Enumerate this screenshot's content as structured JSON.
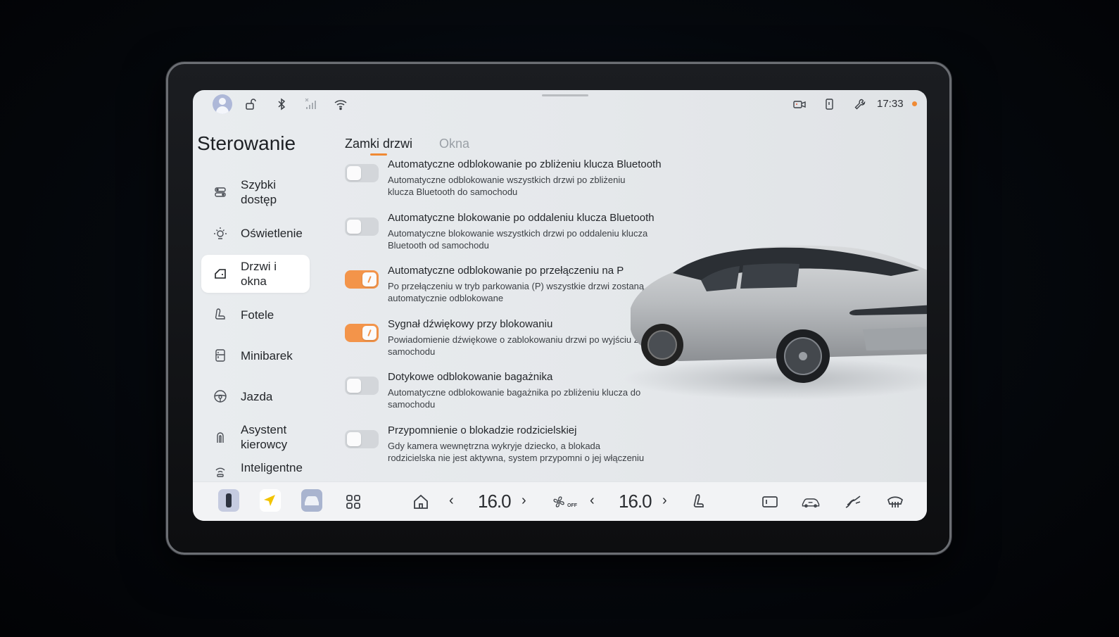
{
  "status_bar": {
    "time": "17:33",
    "icons": [
      "avatar",
      "unlock-icon",
      "bluetooth-icon",
      "no-signal-icon",
      "wifi-icon",
      "camera-icon",
      "phone-key-icon",
      "wrench-icon"
    ],
    "accent_color": "#f08a34"
  },
  "sidebar": {
    "title": "Sterowanie",
    "items": [
      {
        "label": "Szybki dostęp",
        "icon": "quick-access-icon",
        "active": false
      },
      {
        "label": "Oświetlenie",
        "icon": "light-icon",
        "active": false
      },
      {
        "label": "Drzwi i okna",
        "icon": "door-icon",
        "active": true
      },
      {
        "label": "Fotele",
        "icon": "seat-icon",
        "active": false
      },
      {
        "label": "Minibarek",
        "icon": "fridge-icon",
        "active": false
      },
      {
        "label": "Jazda",
        "icon": "steering-wheel-icon",
        "active": false
      },
      {
        "label": "Asystent kierowcy",
        "icon": "assistant-icon",
        "active": false
      },
      {
        "label": "Inteligentne",
        "icon": "smart-icon",
        "active": false
      }
    ]
  },
  "tabs": [
    {
      "label": "Zamki drzwi",
      "active": true
    },
    {
      "label": "Okna",
      "active": false
    }
  ],
  "settings": [
    {
      "title": "Automatyczne odblokowanie po zbliżeniu klucza Bluetooth",
      "description": "Automatyczne odblokowanie wszystkich drzwi po zbliżeniu klucza Bluetooth do samochodu",
      "enabled": false
    },
    {
      "title": "Automatyczne blokowanie po oddaleniu klucza Bluetooth",
      "description": "Automatyczne blokowanie wszystkich drzwi po oddaleniu klucza Bluetooth od samochodu",
      "enabled": false
    },
    {
      "title": "Automatyczne odblokowanie po przełączeniu na P",
      "description": "Po przełączeniu w tryb parkowania (P) wszystkie drzwi zostaną automatycznie odblokowane",
      "enabled": true
    },
    {
      "title": "Sygnał dźwiękowy przy blokowaniu",
      "description": "Powiadomienie dźwiękowe o zablokowaniu drzwi po wyjściu z samochodu",
      "enabled": true
    },
    {
      "title": "Dotykowe odblokowanie bagażnika",
      "description": "Automatyczne odblokowanie bagażnika po zbliżeniu klucza do samochodu",
      "enabled": false
    },
    {
      "title": "Przypomnienie o blokadzie rodzicielskiej",
      "description": "Gdy kamera wewnętrzna wykryje dziecko, a blokada rodzicielska nie jest aktywna, system przypomni o jej włączeniu",
      "enabled": false
    }
  ],
  "dock": {
    "left_temp": "16.0",
    "right_temp": "16.0",
    "fan_status": "OFF",
    "icons": [
      "phone-app-icon",
      "navigation-app-icon",
      "car-app-icon",
      "apps-grid-icon",
      "home-icon",
      "fan-icon",
      "seat-heat-icon",
      "rear-screen-icon",
      "car-climate-icon",
      "windshield-icon",
      "rear-defrost-icon"
    ]
  }
}
